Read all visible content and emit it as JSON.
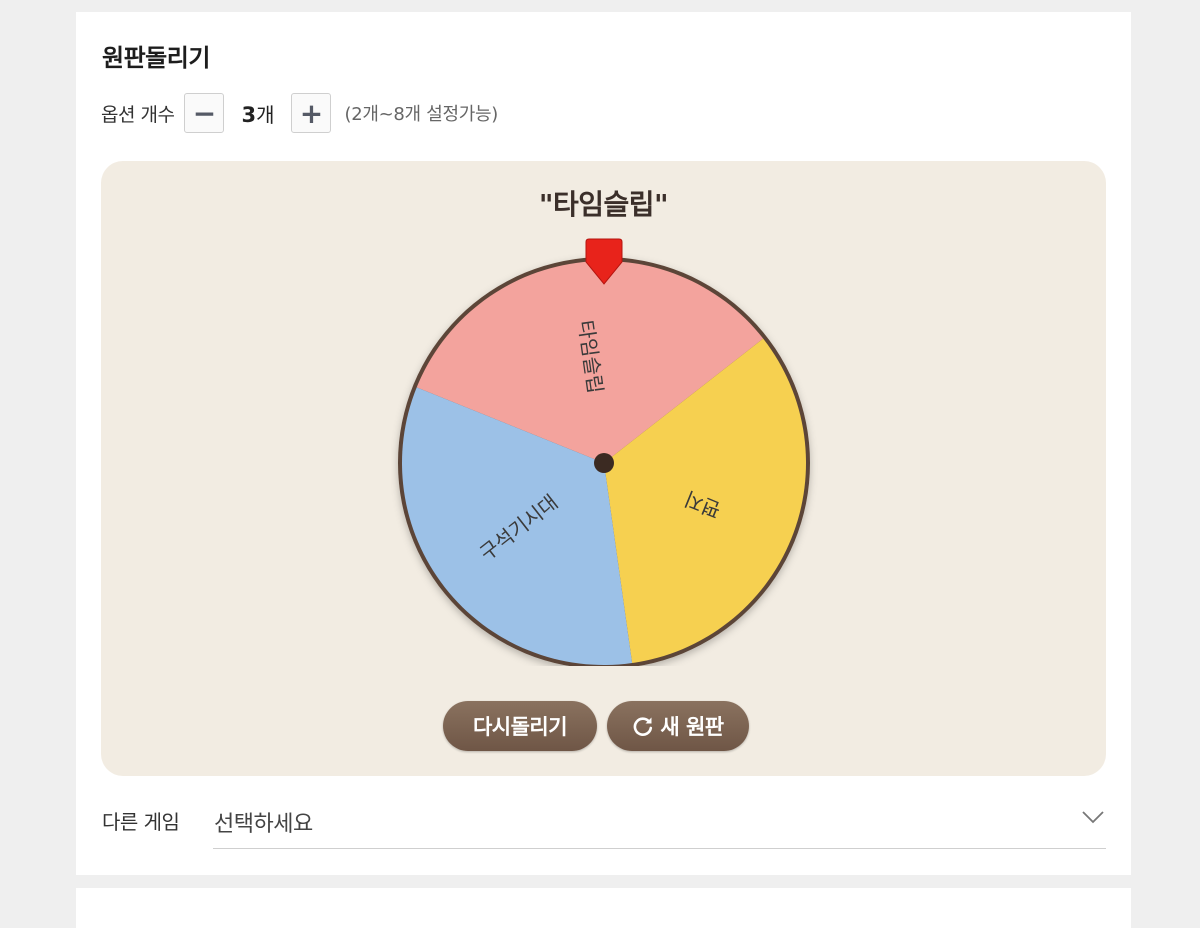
{
  "title": "원판돌리기",
  "options": {
    "label": "옵션 개수",
    "decrement_label": "−",
    "increment_label": "+",
    "count_value": "3",
    "count_unit": "개",
    "range_hint": "(2개~8개 설정가능)"
  },
  "wheel": {
    "result_text": "\"타임슬립\"",
    "segments": [
      {
        "label": "타임슬립",
        "color": "#f3a39d"
      },
      {
        "label": "편지",
        "color": "#f6d050"
      },
      {
        "label": "구석기시대",
        "color": "#9cc1e7"
      }
    ],
    "rim_color": "#5b4537",
    "pointer_color": "#e8231b"
  },
  "actions": {
    "spin_again_label": "다시돌리기",
    "new_wheel_label": "새 원판"
  },
  "other_game": {
    "label": "다른 게임",
    "placeholder": "선택하세요"
  }
}
